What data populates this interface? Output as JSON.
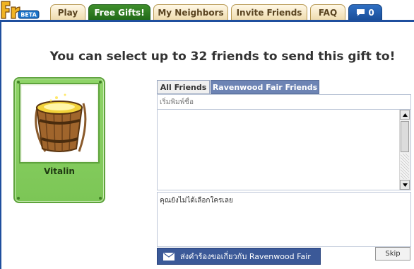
{
  "nav": {
    "tabs": [
      {
        "label": "Play"
      },
      {
        "label": "Free Gifts!"
      },
      {
        "label": "My Neighbors"
      },
      {
        "label": "Invite Friends"
      },
      {
        "label": "FAQ"
      }
    ],
    "message_count": "0",
    "logo_badge": "BETA"
  },
  "headline": "You can select up to 32 friends to send this gift to!",
  "gift": {
    "name": "Vitalin",
    "icon": "wooden-bucket-icon"
  },
  "friend_selector": {
    "tabs": [
      "All Friends",
      "Ravenwood Fair Friends"
    ],
    "search_placeholder": "เริ่มพิมพ์ชื่อ",
    "selected_status": "คุณยังไม่ได้เลือกใครเลย"
  },
  "actions": {
    "send_label": "ส่งคำร้องขอเกี่ยวกับ Ravenwood Fair",
    "skip_label": "Skip"
  },
  "colors": {
    "active_tab": "#2f7d22",
    "message_tab": "#1a5bb0",
    "brand_blue": "#3b5998",
    "card_green": "#86cf5f"
  }
}
